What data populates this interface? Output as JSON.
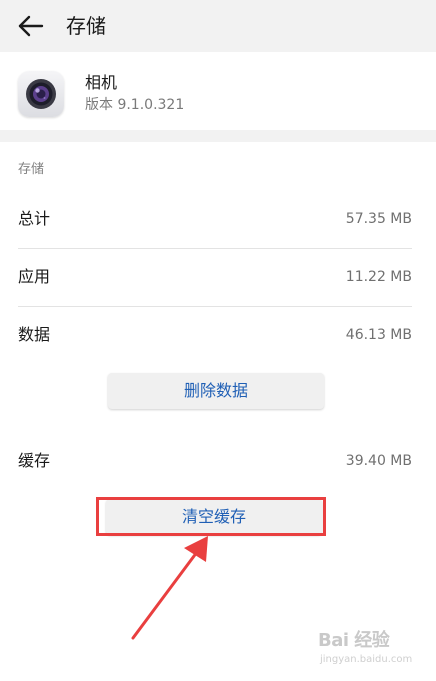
{
  "header": {
    "title": "存储"
  },
  "app": {
    "name": "相机",
    "version": "版本 9.1.0.321",
    "icon": "camera-icon"
  },
  "storage": {
    "section_label": "存储",
    "rows": [
      {
        "label": "总计",
        "value": "57.35 MB"
      },
      {
        "label": "应用",
        "value": "11.22 MB"
      },
      {
        "label": "数据",
        "value": "46.13 MB"
      }
    ],
    "delete_data_label": "删除数据",
    "cache": {
      "label": "缓存",
      "value": "39.40 MB"
    },
    "clear_cache_label": "清空缓存"
  },
  "watermark": {
    "text": "Bai 经验",
    "sub": "jingyan.baidu.com"
  },
  "colors": {
    "accent_text": "#1f5fb5",
    "highlight": "#e93f3f",
    "header_bg": "#f2f2f2"
  }
}
